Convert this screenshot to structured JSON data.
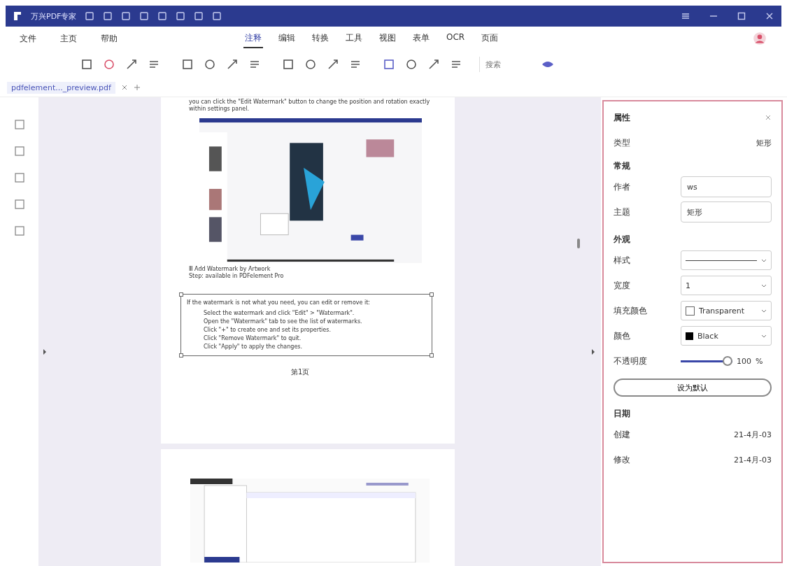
{
  "window": {
    "title": "万兴PDF专家"
  },
  "menu": [
    {
      "label": "文件"
    },
    {
      "label": "主页"
    },
    {
      "label": "帮助"
    }
  ],
  "ribbon_tabs": [
    {
      "label": "注释",
      "selected": true
    },
    {
      "label": "编辑",
      "selected": false
    },
    {
      "label": "转换",
      "selected": false
    },
    {
      "label": "工具",
      "selected": false
    },
    {
      "label": "视图",
      "selected": false
    },
    {
      "label": "表单",
      "selected": false
    },
    {
      "label": "OCR",
      "selected": false
    },
    {
      "label": "页面",
      "selected": false
    }
  ],
  "toolbar": {
    "search": {
      "placeholder": "搜索"
    }
  },
  "document_tab": {
    "label": "pdfelement..._preview.pdf"
  },
  "page": {
    "top_text": "you can click the \"Edit Watermark\" button to change the position and rotation exactly within settings panel.",
    "caption_lines": [
      "Ⅲ Add Watermark by Artwork",
      "Step: available in PDFelement Pro"
    ],
    "note_text": "If the watermark is not what you need, you can edit or remove it:",
    "bullets": [
      "Select the watermark and click \"Edit\" > \"Watermark\".",
      "Open the \"Watermark\" tab to see the list of watermarks.",
      "Click \"+\" to create one and set its properties.",
      "Click \"Remove Watermark\" to quit.",
      "Click \"Apply\" to apply the changes."
    ],
    "page_label": "第1页"
  },
  "panel": {
    "title": "属性",
    "type_label": "类型",
    "type_value": "矩形",
    "general_heading": "常规",
    "author_label": "作者",
    "author_value": "ws",
    "subject_label": "主题",
    "subject_value": "矩形",
    "appearance_heading": "外观",
    "style_label": "样式",
    "width_label": "宽度",
    "width_value": "1",
    "fill_label": "填充颜色",
    "fill_value": "Transparent",
    "color_label": "颜色",
    "color_value": "Black",
    "opacity_label": "不透明度",
    "opacity": {
      "level": 1.0
    },
    "opacity_value": "100",
    "opacity_unit": "%",
    "default_button": "设为默认",
    "date_heading": "日期",
    "created_label": "创建",
    "created_value": "21-4月-03",
    "modified_label": "修改",
    "modified_value": "21-4月-03"
  }
}
